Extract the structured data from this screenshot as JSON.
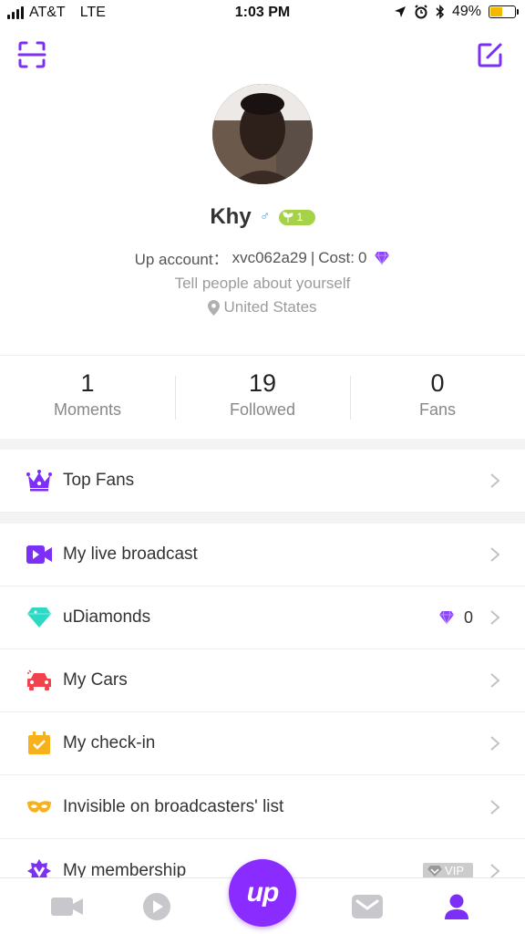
{
  "status_bar": {
    "carrier": "AT&T",
    "network": "LTE",
    "time": "1:03 PM",
    "battery": "49%",
    "battery_level": 0.49
  },
  "header": {
    "left_icon": "scan-icon",
    "right_icon": "edit-icon"
  },
  "profile": {
    "name": "Khy",
    "gender_symbol": "♂",
    "level": "1",
    "account_label": "Up account：",
    "account_id": "xvc062a29",
    "separator": "|",
    "cost_label": "Cost:",
    "cost_value": "0",
    "bio": "Tell people about yourself",
    "location": "United States"
  },
  "stats": [
    {
      "value": "1",
      "label": "Moments"
    },
    {
      "value": "19",
      "label": "Followed"
    },
    {
      "value": "0",
      "label": "Fans"
    }
  ],
  "menu": {
    "top_fans": "Top Fans",
    "live_broadcast": "My live broadcast",
    "udiamonds": "uDiamonds",
    "udiamonds_value": "0",
    "cars": "My Cars",
    "checkin": "My check-in",
    "invisible": "Invisible on broadcasters' list",
    "membership": "My membership",
    "vip": "VIP"
  },
  "tabbar": {
    "center_label": "up",
    "tabs": [
      "video-icon",
      "play-icon",
      "mail-icon",
      "profile-icon"
    ]
  },
  "colors": {
    "accent": "#7b2ff7",
    "diamond": "#8e44ff",
    "udiamond": "#2dd8c4",
    "cars": "#f2424b",
    "checkin": "#f7b21b",
    "mask": "#f7b21b",
    "level_badge": "#a6d24a"
  }
}
